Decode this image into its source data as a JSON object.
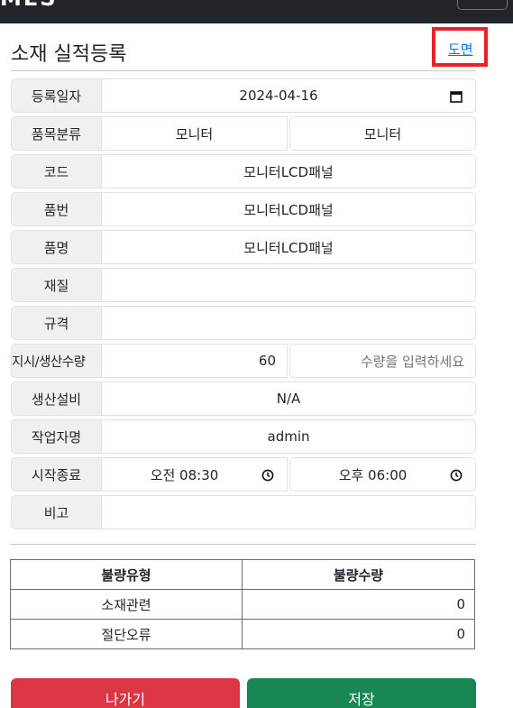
{
  "header": {
    "brand_fragment": "MES",
    "menu_icon": "hamburger-icon"
  },
  "page": {
    "title": "소재 실적등록",
    "drawing_link": "도면",
    "highlight_color": "#e8212a"
  },
  "form": {
    "reg_date": {
      "label": "등록일자",
      "value": "2024-04-16"
    },
    "item_class": {
      "label": "품목분류",
      "value1": "모니터",
      "value2": "모니터"
    },
    "code": {
      "label": "코드",
      "value": "모니터LCD패널"
    },
    "part_no": {
      "label": "품번",
      "value": "모니터LCD패널"
    },
    "part_name": {
      "label": "품명",
      "value": "모니터LCD패널"
    },
    "material": {
      "label": "재질",
      "value": ""
    },
    "spec": {
      "label": "규격",
      "value": ""
    },
    "qty": {
      "label": "지시/생산수량",
      "order_value": "60",
      "input_placeholder": "수량을 입력하세요"
    },
    "equipment": {
      "label": "생산설비",
      "value": "N/A"
    },
    "worker": {
      "label": "작업자명",
      "value": "admin"
    },
    "time": {
      "label": "시작종료",
      "start": "오전 08:30",
      "end": "오후 06:00"
    },
    "note": {
      "label": "비고",
      "value": ""
    }
  },
  "defects": {
    "headers": [
      "불량유형",
      "불량수량"
    ],
    "rows": [
      {
        "type": "소재관련",
        "qty": "0"
      },
      {
        "type": "절단오류",
        "qty": "0"
      }
    ]
  },
  "buttons": {
    "exit": "나가기",
    "save": "저장"
  },
  "colors": {
    "danger": "#dc3545",
    "success": "#198754",
    "link": "#0d6efd",
    "navbar": "#212529"
  }
}
